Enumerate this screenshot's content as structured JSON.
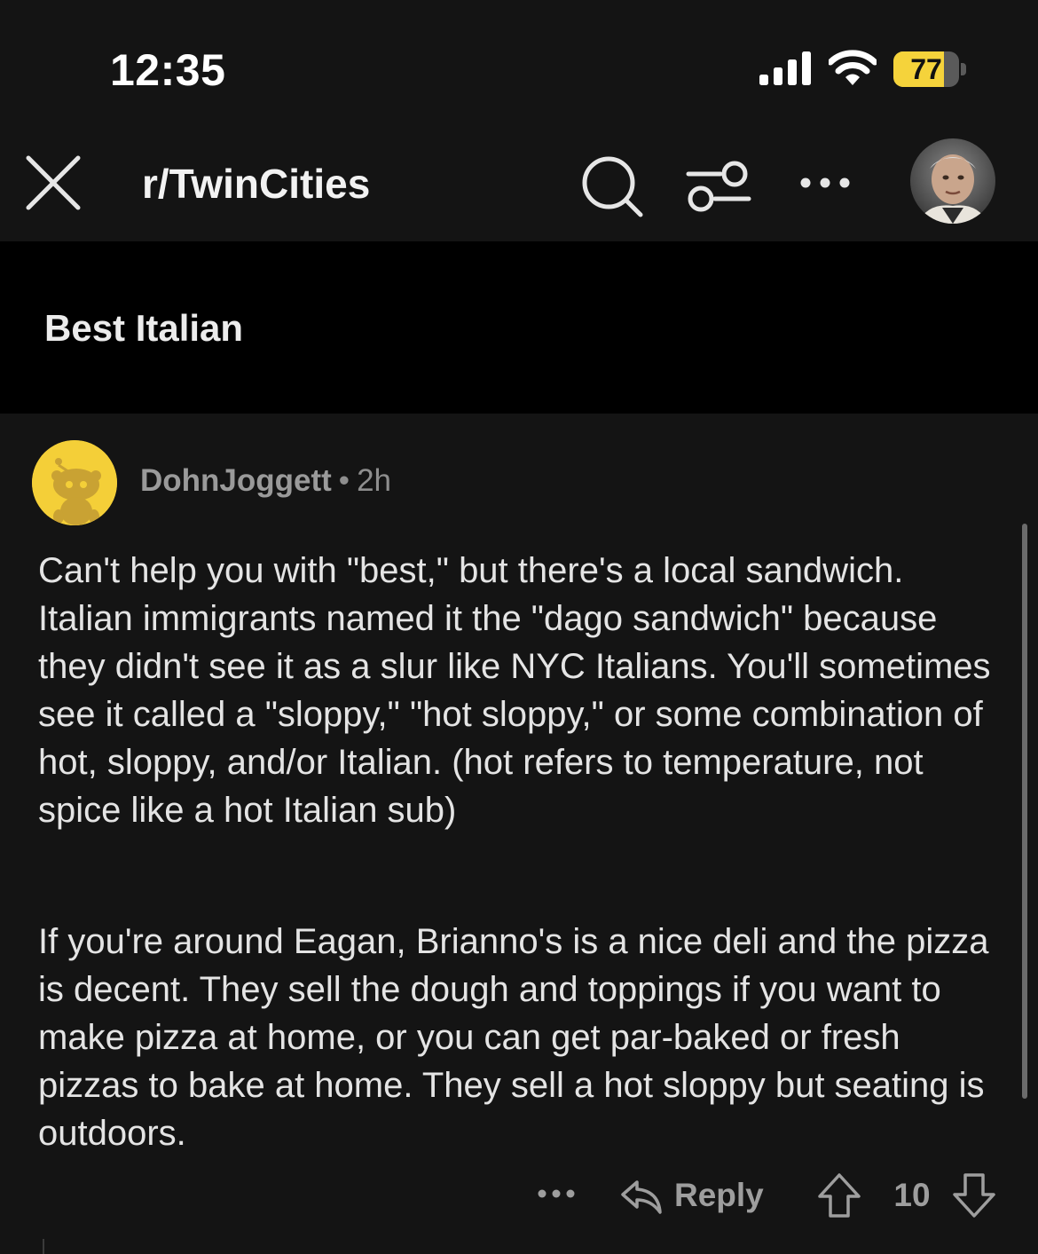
{
  "status_bar": {
    "time": "12:35",
    "battery_level": "77",
    "battery_fraction": 0.77,
    "icons": [
      "cellular-signal-icon",
      "wifi-icon",
      "battery-icon"
    ]
  },
  "nav": {
    "subreddit": "r/TwinCities",
    "icons": [
      "close-icon",
      "search-icon",
      "filter-icon",
      "more-icon",
      "user-avatar"
    ]
  },
  "post": {
    "title": "Best Italian"
  },
  "comment": {
    "author": "DohnJoggett",
    "separator": "•",
    "age": "2h",
    "paragraphs": [
      "Can't help you with \"best,\" but there's a local sandwich. Italian immigrants named it the \"dago sandwich\" because they didn't see it as a slur like NYC Italians. You'll sometimes see it called a \"sloppy,\" \"hot sloppy,\" or some combination of hot, sloppy, and/or Italian. (hot refers to temperature, not spice like a hot Italian sub)",
      "If you're around Eagan, Brianno's is a nice deli and the pizza is decent. They sell the dough and toppings if you want to make pizza at home, or you can get par-baked or fresh pizzas to bake at home. They sell a hot sloppy but seating is outdoors."
    ],
    "actions": {
      "reply_label": "Reply",
      "vote_count": "10"
    }
  },
  "colors": {
    "background": "#141414",
    "post_band": "#000000",
    "battery_fill": "#f5d33b",
    "snoo_avatar": "#f4cf38",
    "muted_text": "#9e9e9e"
  }
}
